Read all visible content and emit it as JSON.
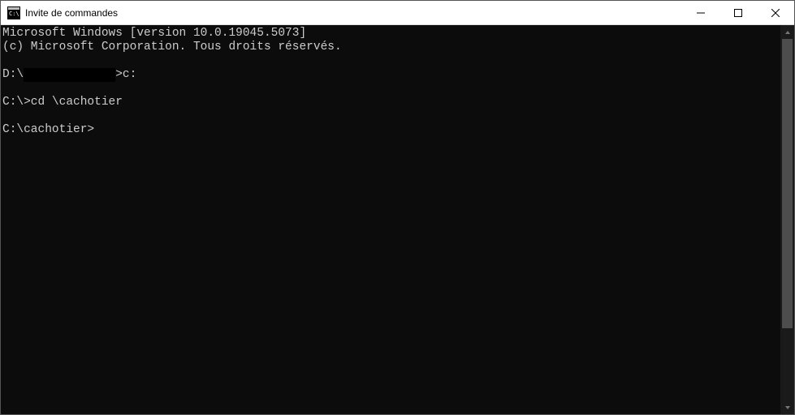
{
  "window": {
    "title": "Invite de commandes"
  },
  "terminal": {
    "line1": "Microsoft Windows [version 10.0.19045.5073]",
    "line2": "(c) Microsoft Corporation. Tous droits réservés.",
    "line3_prefix": "D:\\",
    "line3_redacted": "             ",
    "line3_suffix": ">c:",
    "line4": "C:\\>cd \\cachotier",
    "line5": "C:\\cachotier>"
  }
}
